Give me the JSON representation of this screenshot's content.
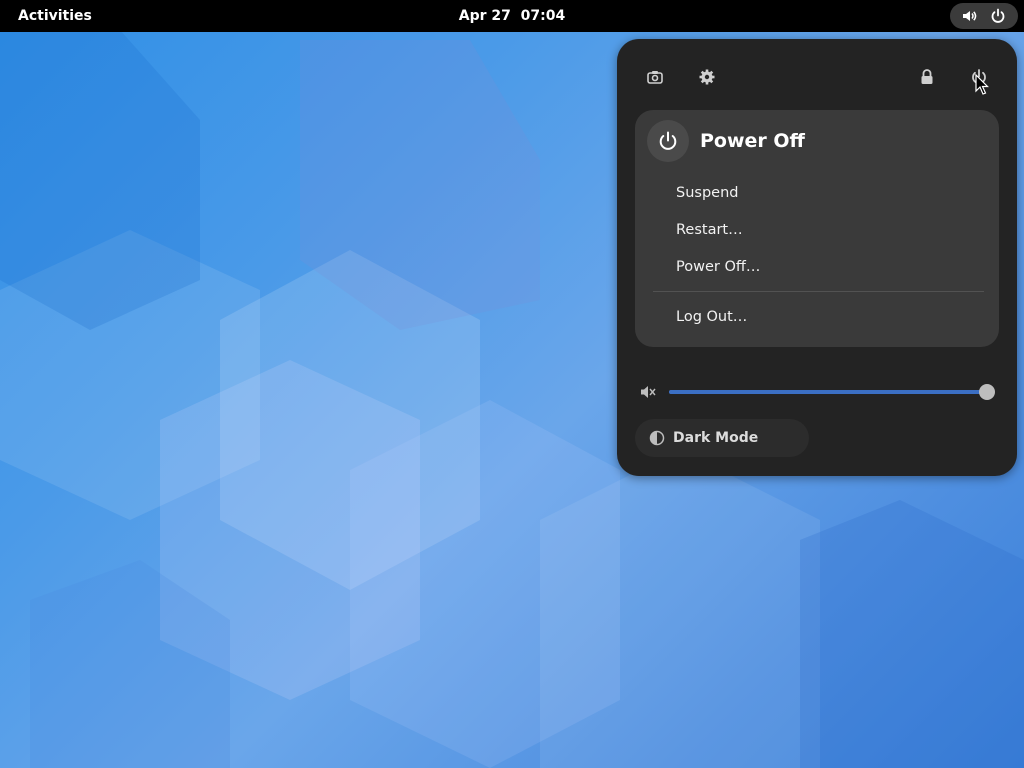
{
  "topbar": {
    "activities_label": "Activities",
    "date": "Apr 27",
    "time": "07:04"
  },
  "quick_settings": {
    "buttons": [
      "camera-icon",
      "gear-icon",
      "lock-icon",
      "power-icon"
    ],
    "power_menu": {
      "title": "Power Off",
      "items": [
        {
          "label": "Suspend"
        },
        {
          "label": "Restart…"
        },
        {
          "label": "Power Off…"
        },
        {
          "label": "Log Out…"
        }
      ]
    },
    "volume": {
      "level": 1.0,
      "accent_color": "#3b6fc4",
      "icon": "speaker-muted-icon"
    },
    "dark_mode": {
      "label": "Dark Mode",
      "icon": "half-circle-icon"
    }
  },
  "colors": {
    "topbar": "#000000",
    "panel": "#232323",
    "menu": "#3a3a3a"
  }
}
